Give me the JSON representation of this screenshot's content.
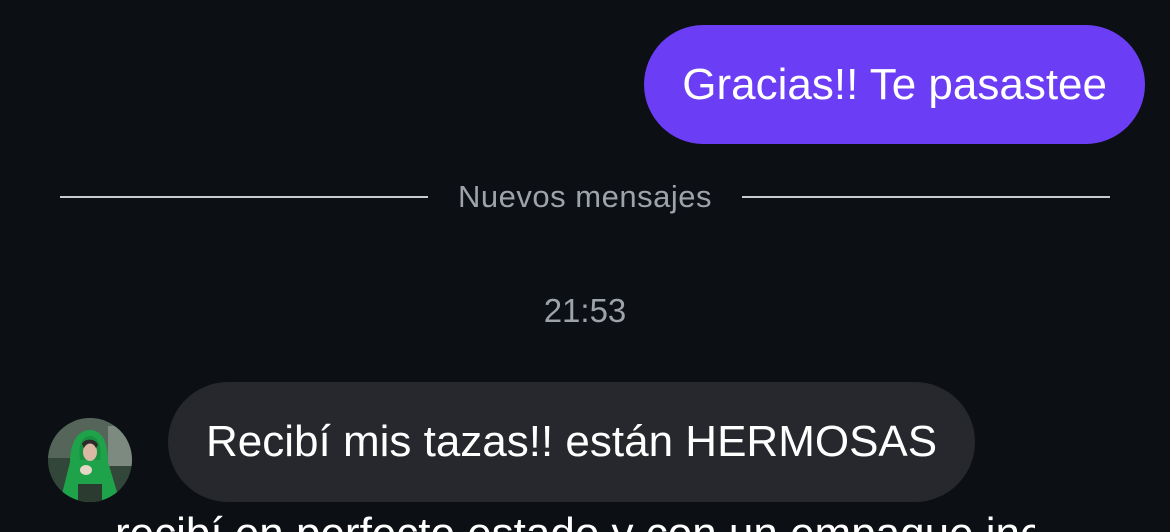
{
  "messages": {
    "outgoing_1": {
      "text": "Gracias!! Te pasastee"
    },
    "incoming_1": {
      "text": "Recibí mis tazas!! están HERMOSAS"
    },
    "incoming_2_partial": {
      "text": "recibí en perfecto estado y con un empaque increíble"
    }
  },
  "divider": {
    "label": "Nuevos mensajes"
  },
  "timestamp": {
    "time": "21:53"
  },
  "contact": {
    "avatar_icon": "user-avatar-photo"
  },
  "colors": {
    "background": "#0c0f14",
    "outgoing_bubble": "#6b3ef5",
    "incoming_bubble": "#26282d",
    "muted_text": "#9ea2a9",
    "divider_line": "#c9cbd0"
  }
}
